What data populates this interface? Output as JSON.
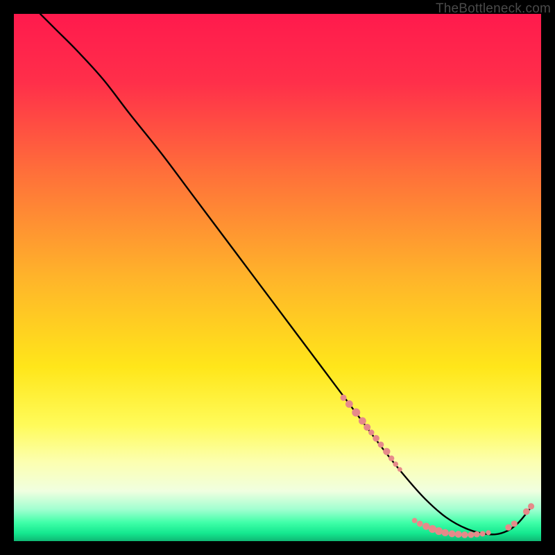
{
  "watermark": "TheBottleneck.com",
  "colors": {
    "gradient_stops": [
      {
        "offset": 0,
        "color": "#ff1a4d"
      },
      {
        "offset": 0.13,
        "color": "#ff2f4a"
      },
      {
        "offset": 0.3,
        "color": "#ff6f3a"
      },
      {
        "offset": 0.5,
        "color": "#ffb42a"
      },
      {
        "offset": 0.67,
        "color": "#ffe61a"
      },
      {
        "offset": 0.78,
        "color": "#fffb5a"
      },
      {
        "offset": 0.85,
        "color": "#fcffb0"
      },
      {
        "offset": 0.905,
        "color": "#f0ffe0"
      },
      {
        "offset": 0.94,
        "color": "#a0ffd0"
      },
      {
        "offset": 0.965,
        "color": "#3fffa8"
      },
      {
        "offset": 0.985,
        "color": "#14e88f"
      },
      {
        "offset": 1.0,
        "color": "#0fb874"
      }
    ],
    "curve": "#000000",
    "dot_fill": "#e68a8a",
    "dot_stroke": "#b85a5a"
  },
  "chart_data": {
    "type": "line",
    "title": "",
    "xlabel": "",
    "ylabel": "",
    "xlim": [
      0,
      100
    ],
    "ylim": [
      0,
      100
    ],
    "grid": false,
    "legend": false,
    "series": [
      {
        "name": "curve",
        "x": [
          5,
          8,
          12,
          17,
          22,
          28,
          34,
          40,
          46,
          52,
          58,
          64,
          70,
          74,
          78,
          82,
          86,
          90,
          93,
          95.5,
          98
        ],
        "y": [
          100,
          97,
          93,
          87.5,
          81,
          73.5,
          65.5,
          57.5,
          49.5,
          41.5,
          33.5,
          25.5,
          17.5,
          12.5,
          8,
          4.5,
          2.3,
          1.3,
          1.7,
          3.3,
          6.3
        ]
      }
    ],
    "scatter_clusters": [
      {
        "name": "upper-band-dots",
        "approx_x_range": [
          62,
          73
        ],
        "approx_y_range": [
          15,
          27
        ],
        "count_estimate": 14
      },
      {
        "name": "valley-dots",
        "approx_x_range": [
          76,
          92
        ],
        "approx_y_range": [
          1,
          4
        ],
        "count_estimate": 18
      },
      {
        "name": "tail-dots",
        "approx_x_range": [
          93,
          98
        ],
        "approx_y_range": [
          2,
          7
        ],
        "count_estimate": 5
      }
    ],
    "dots": [
      {
        "x": 62.5,
        "y": 27.2,
        "r": 4.5
      },
      {
        "x": 63.6,
        "y": 26.0,
        "r": 5.4
      },
      {
        "x": 64.9,
        "y": 24.4,
        "r": 6.0
      },
      {
        "x": 66.1,
        "y": 22.8,
        "r": 5.4
      },
      {
        "x": 67.0,
        "y": 21.6,
        "r": 5.0
      },
      {
        "x": 67.8,
        "y": 20.6,
        "r": 4.2
      },
      {
        "x": 68.7,
        "y": 19.5,
        "r": 4.8
      },
      {
        "x": 69.6,
        "y": 18.3,
        "r": 4.4
      },
      {
        "x": 70.7,
        "y": 17.0,
        "r": 5.2
      },
      {
        "x": 71.6,
        "y": 15.7,
        "r": 4.2
      },
      {
        "x": 72.4,
        "y": 14.6,
        "r": 3.8
      },
      {
        "x": 73.2,
        "y": 13.6,
        "r": 3.4
      },
      {
        "x": 76.0,
        "y": 3.9,
        "r": 3.8
      },
      {
        "x": 77.0,
        "y": 3.3,
        "r": 4.4
      },
      {
        "x": 78.2,
        "y": 2.8,
        "r": 5.2
      },
      {
        "x": 79.4,
        "y": 2.3,
        "r": 5.6
      },
      {
        "x": 80.6,
        "y": 1.9,
        "r": 5.6
      },
      {
        "x": 81.8,
        "y": 1.6,
        "r": 5.2
      },
      {
        "x": 83.1,
        "y": 1.4,
        "r": 5.0
      },
      {
        "x": 84.3,
        "y": 1.3,
        "r": 5.0
      },
      {
        "x": 85.5,
        "y": 1.2,
        "r": 4.8
      },
      {
        "x": 86.7,
        "y": 1.2,
        "r": 4.6
      },
      {
        "x": 87.8,
        "y": 1.3,
        "r": 4.4
      },
      {
        "x": 88.9,
        "y": 1.4,
        "r": 4.0
      },
      {
        "x": 90.0,
        "y": 1.6,
        "r": 3.6
      },
      {
        "x": 93.8,
        "y": 2.6,
        "r": 4.6
      },
      {
        "x": 94.9,
        "y": 3.3,
        "r": 4.6
      },
      {
        "x": 97.2,
        "y": 5.6,
        "r": 4.8
      },
      {
        "x": 98.1,
        "y": 6.6,
        "r": 4.6
      }
    ]
  }
}
